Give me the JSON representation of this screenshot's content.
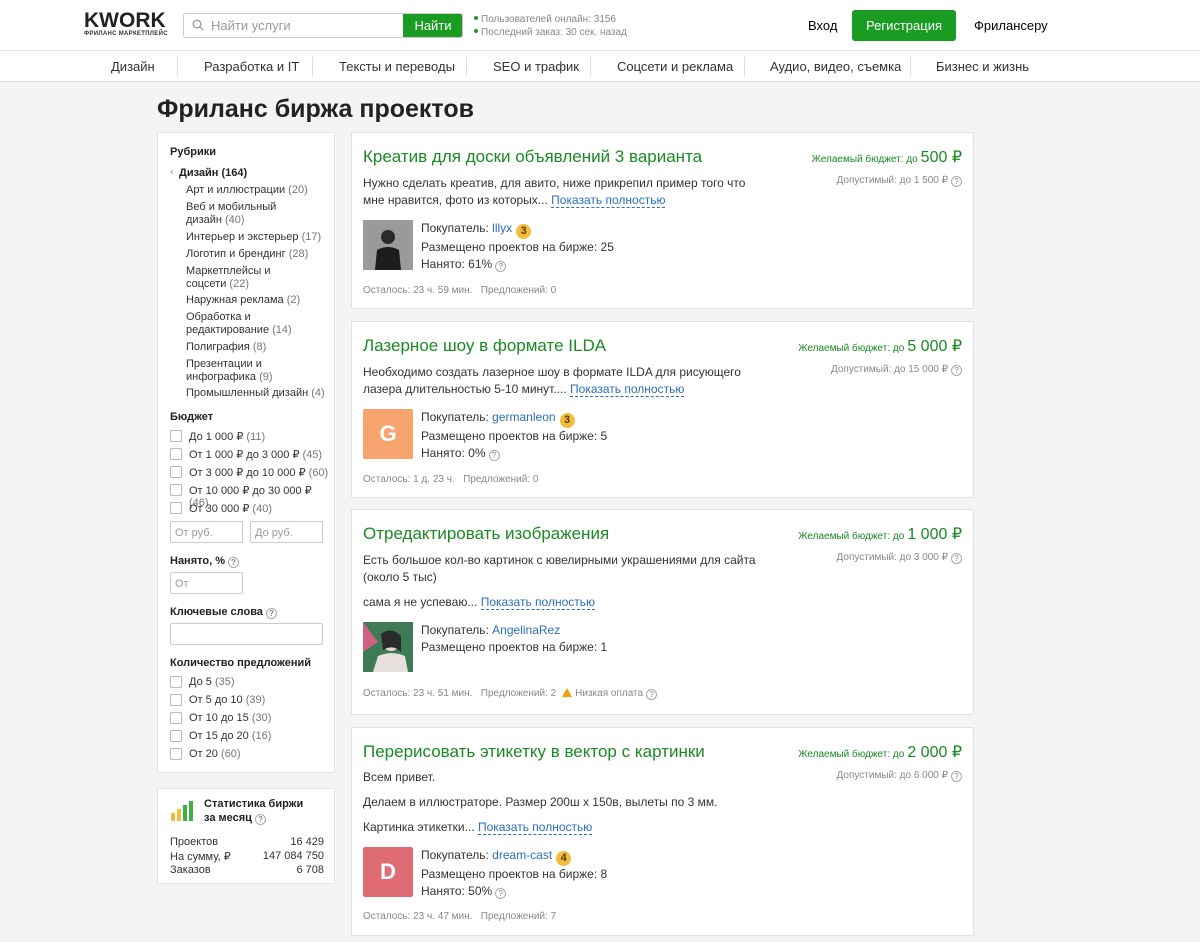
{
  "header": {
    "logo": "KWORK",
    "logo_sub": "ФРИЛАНС МАРКЕТПЛЕЙС",
    "search_placeholder": "Найти услуги",
    "search_button": "Найти",
    "stat_online": "Пользователей онлайн: 3156",
    "stat_last_order": "Последний заказ: 30 сек. назад",
    "login": "Вход",
    "register": "Регистрация",
    "freelancer": "Фрилансеру"
  },
  "categories": [
    "Дизайн",
    "Разработка и IT",
    "Тексты и переводы",
    "SEO и трафик",
    "Соцсети и реклама",
    "Аудио, видео, съемка",
    "Бизнес и жизнь"
  ],
  "page_title": "Фриланс биржа проектов",
  "sidebar": {
    "rubrics_title": "Рубрики",
    "active_rubric": "Дизайн (164)",
    "subrubrics": [
      {
        "name": "Арт и иллюстрации",
        "count": "(20)"
      },
      {
        "name": "Веб и мобильный дизайн",
        "count": "(40)"
      },
      {
        "name": "Интерьер и экстерьер",
        "count": "(17)"
      },
      {
        "name": "Логотип и брендинг",
        "count": "(28)"
      },
      {
        "name": "Маркетплейсы и соцсети",
        "count": "(22)"
      },
      {
        "name": "Наружная реклама",
        "count": "(2)"
      },
      {
        "name": "Обработка и редактирование",
        "count": "(14)"
      },
      {
        "name": "Полиграфия",
        "count": "(8)"
      },
      {
        "name": "Презентации и инфографика",
        "count": "(9)"
      },
      {
        "name": "Промышленный дизайн",
        "count": "(4)"
      }
    ],
    "budget_title": "Бюджет",
    "budget_options": [
      {
        "label": "До 1 000 ₽",
        "count": "(11)"
      },
      {
        "label": "От 1 000 ₽ до 3 000 ₽",
        "count": "(45)"
      },
      {
        "label": "От 3 000 ₽ до 10 000 ₽",
        "count": "(60)"
      },
      {
        "label": "От 10 000 ₽ до 30 000 ₽",
        "count": "(46)"
      },
      {
        "label": "От 30 000 ₽",
        "count": "(40)"
      }
    ],
    "budget_from_placeholder": "От руб.",
    "budget_to_placeholder": "До руб.",
    "hired_title": "Нанято, %",
    "hired_placeholder": "От",
    "keywords_title": "Ключевые слова",
    "offers_title": "Количество предложений",
    "offers_options": [
      {
        "label": "До 5",
        "count": "(35)"
      },
      {
        "label": "От 5 до 10",
        "count": "(39)"
      },
      {
        "label": "От 10 до 15",
        "count": "(30)"
      },
      {
        "label": "От 15 до 20",
        "count": "(16)"
      },
      {
        "label": "От 20",
        "count": "(60)"
      }
    ]
  },
  "stats": {
    "title_line1": "Статистика биржи",
    "title_line2": "за месяц",
    "rows": [
      {
        "label": "Проектов",
        "value": "16 429"
      },
      {
        "label": "На сумму, ₽",
        "value": "147 084 750"
      },
      {
        "label": "Заказов",
        "value": "6 708"
      }
    ]
  },
  "projects": [
    {
      "title": "Креатив для доски объявлений 3 варианта",
      "budget_label": "Желаемый бюджет: до",
      "budget": "500 ₽",
      "permitted": "Допустимый: до 1 500 ₽",
      "desc": [
        "Нужно сделать креатив, для авито, ниже прикрепил пример того что мне нравится, фото из которых..."
      ],
      "show_full": "Показать полностью",
      "buyer_label": "Покупатель:",
      "buyer": "lllyx",
      "level": "3",
      "avatar_letter": "",
      "avatar_color": "#444444",
      "placed": "Размещено проектов на бирже: 25",
      "hired": "Нанято: 61%",
      "remaining": "Осталось: 23 ч. 59 мин.",
      "offers": "Предложений: 0",
      "warning": ""
    },
    {
      "title": "Лазерное шоу в формате ILDA",
      "budget_label": "Желаемый бюджет: до",
      "budget": "5 000 ₽",
      "permitted": "Допустимый: до 15 000 ₽",
      "desc": [
        "Необходимо создать лазерное шоу в формате ILDA для рисующего лазера длительностью 5-10 минут...."
      ],
      "show_full": "Показать полностью",
      "buyer_label": "Покупатель:",
      "buyer": "germanleon",
      "level": "3",
      "avatar_letter": "G",
      "avatar_color": "#f7a46e",
      "placed": "Размещено проектов на бирже: 5",
      "hired": "Нанято: 0%",
      "remaining": "Осталось: 1 д. 23 ч.",
      "offers": "Предложений: 0",
      "warning": ""
    },
    {
      "title": "Отредактировать изображения",
      "budget_label": "Желаемый бюджет: до",
      "budget": "1 000 ₽",
      "permitted": "Допустимый: до 3 000 ₽",
      "desc": [
        "Есть большое кол-во картинок с ювелирными украшениями для сайта (около 5 тыс)",
        "сама я не успеваю..."
      ],
      "show_full": "Показать полностью",
      "buyer_label": "Покупатель:",
      "buyer": "AngelinaRez",
      "level": "",
      "avatar_letter": "",
      "avatar_color": "#2e6b4a",
      "placed": "Размещено проектов на бирже: 1",
      "hired": "",
      "remaining": "Осталось: 23 ч. 51 мин.",
      "offers": "Предложений: 2",
      "warning": "Низкая оплата"
    },
    {
      "title": "Перерисовать этикетку в вектор с картинки",
      "budget_label": "Желаемый бюджет: до",
      "budget": "2 000 ₽",
      "permitted": "Допустимый: до 6 000 ₽",
      "desc": [
        "Всем привет.",
        "Делаем в иллюстраторе. Размер 200ш х 150в, вылеты по 3 мм.",
        "Картинка этикетки..."
      ],
      "show_full": "Показать полностью",
      "buyer_label": "Покупатель:",
      "buyer": "dream-cast",
      "level": "4",
      "avatar_letter": "D",
      "avatar_color": "#e06c75",
      "placed": "Размещено проектов на бирже: 8",
      "hired": "Нанято: 50%",
      "remaining": "Осталось: 23 ч. 47 мин.",
      "offers": "Предложений: 7",
      "warning": ""
    }
  ]
}
